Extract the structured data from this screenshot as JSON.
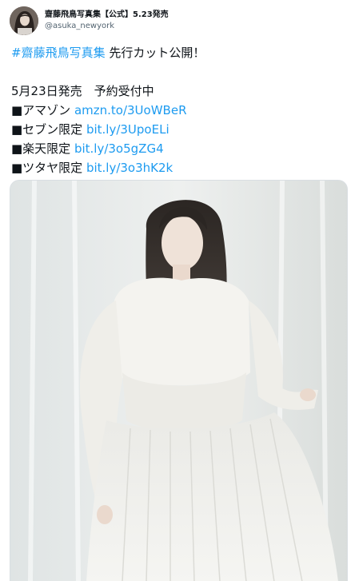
{
  "tweet": {
    "display_name": "齋藤飛鳥写真集【公式】5.23発売",
    "handle": "@asuka_newyork",
    "lines": [
      {
        "text": "#齋藤飛鳥写真集",
        "link": true,
        "suffix": " 先行カット公開！"
      },
      {
        "gap": true
      },
      {
        "text": "5月23日発売　予約受付中"
      },
      {
        "prefix": "■アマゾン ",
        "text": "amzn.to/3UoWBeR",
        "link": true
      },
      {
        "prefix": "■セブン限定 ",
        "text": "bit.ly/3UpoELi",
        "link": true
      },
      {
        "prefix": "■楽天限定 ",
        "text": "bit.ly/3o5gZG4",
        "link": true
      },
      {
        "prefix": "■ツタヤ限定 ",
        "text": "bit.ly/3o3hK2k",
        "link": true
      }
    ]
  },
  "colors": {
    "link": "#1d9bf0",
    "text": "#0f1419",
    "secondary": "#536471"
  },
  "icons": {
    "avatar": "profile-photo"
  }
}
